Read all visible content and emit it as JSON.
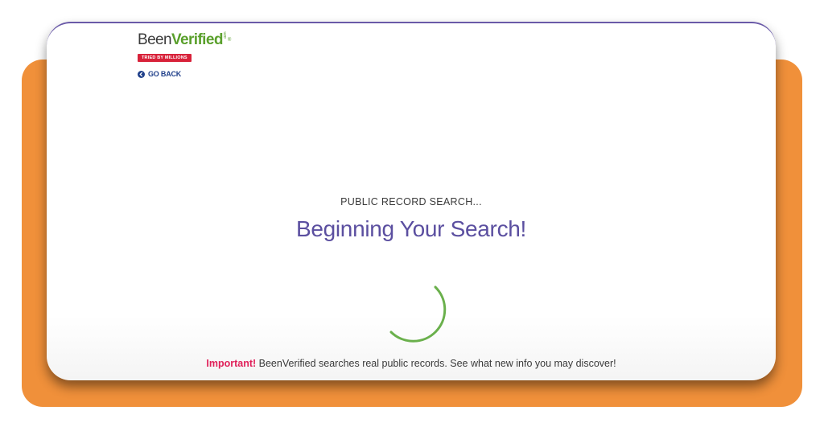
{
  "brand": {
    "name_part1": "Been",
    "name_part2": "Verified",
    "dotcom": ".com",
    "registered": "®",
    "tagline": "TRIED BY MILLIONS"
  },
  "nav": {
    "go_back_label": "GO BACK"
  },
  "search": {
    "kicker": "PUBLIC RECORD SEARCH...",
    "title": "Beginning Your Search!"
  },
  "notice": {
    "strong": "Important!",
    "text": " BeenVerified searches real public records. See what new info you may discover!"
  },
  "colors": {
    "backdrop": "#f0903a",
    "brand_green": "#5aa02c",
    "brand_red": "#d8223a",
    "title_purple": "#5b4fa0",
    "link_blue": "#1f3f8a",
    "important_pink": "#e0215a",
    "spinner_green": "#6ab04c"
  },
  "icons": {
    "go_back": "arrow-left-circle-icon",
    "spinner": "loading-spinner-icon"
  }
}
